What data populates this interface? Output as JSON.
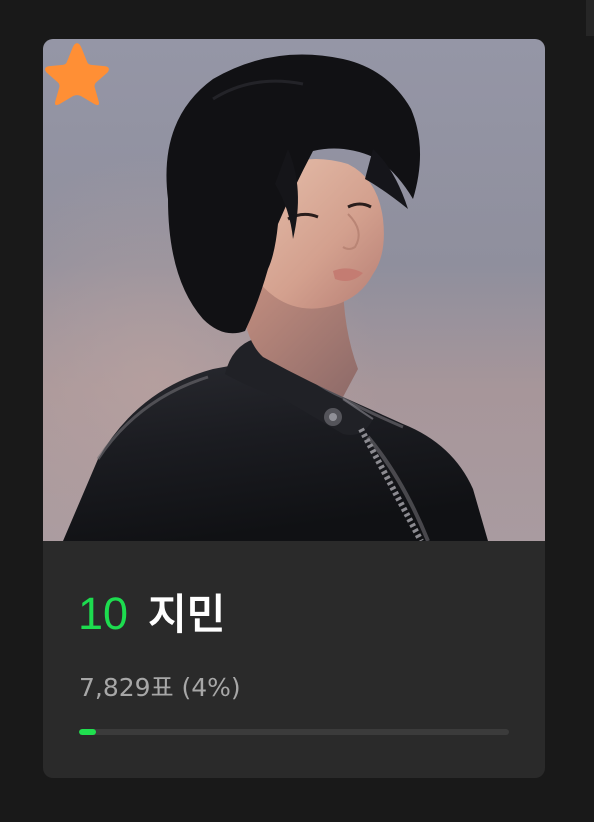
{
  "card": {
    "photo_alt": "지민",
    "favorite_icon": "star-icon",
    "rank": "10",
    "name": "지민",
    "votes_text": "7,829표 (4%)",
    "vote_share_fraction": 0.04
  },
  "colors": {
    "background": "#191919",
    "card": "#2a2a2a",
    "rank": "#1ddc4f",
    "name": "#ffffff",
    "votes": "#a7a7a7",
    "progress_fill": "#20df4f",
    "progress_track": "#3b3b3b",
    "favorite": "#ff8f35"
  }
}
